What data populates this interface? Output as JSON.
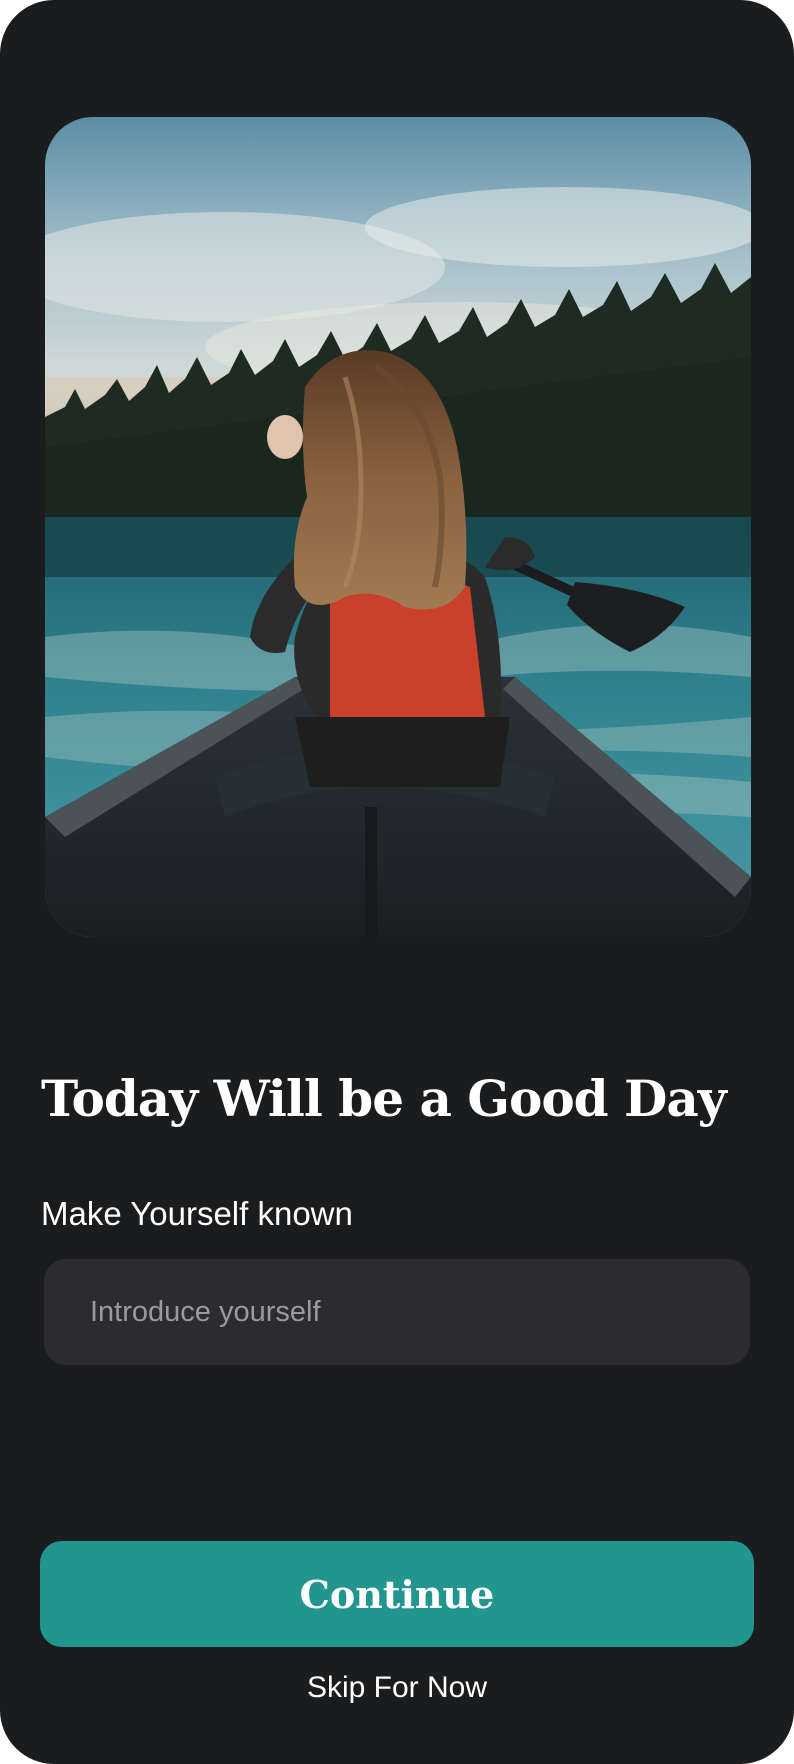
{
  "hero": {
    "image_name": "woman-paddling-canoe-on-lake"
  },
  "headline": "Today Will be a Good Day",
  "intro": {
    "label": "Make Yourself known",
    "placeholder": "Introduce yourself",
    "value": ""
  },
  "actions": {
    "continue_label": "Continue",
    "skip_label": "Skip For Now"
  },
  "colors": {
    "background": "#1b1c1e",
    "input_background": "#2c2c2e",
    "accent": "#22958f",
    "text": "#ffffff",
    "placeholder": "#9b9b9e"
  }
}
